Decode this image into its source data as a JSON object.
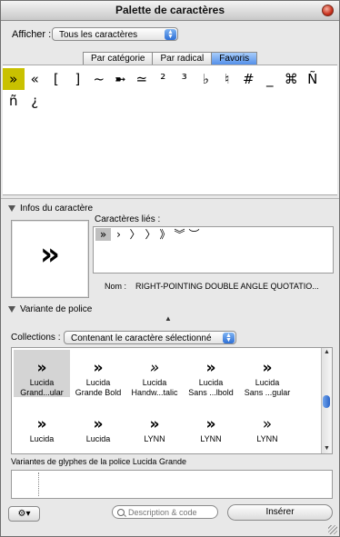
{
  "window": {
    "title": "Palette de caractères"
  },
  "show": {
    "label": "Afficher :",
    "value": "Tous les caractères"
  },
  "tabs": [
    {
      "label": "Par catégorie",
      "selected": false
    },
    {
      "label": "Par radical",
      "selected": false
    },
    {
      "label": "Favoris",
      "selected": true
    }
  ],
  "favorites": [
    "»",
    "«",
    "[",
    "]",
    "~",
    "➼",
    "≃",
    "²",
    "³",
    "♭",
    "♮",
    "#",
    "_",
    "⌘",
    "Ñ",
    "ñ",
    "¿"
  ],
  "selected_index": 0,
  "char_info": {
    "header": "Infos du caractère",
    "preview": "»",
    "linked_label": "Caractères liés :",
    "linked": [
      "»",
      "›",
      "〉",
      "〉",
      "》",
      "︾",
      "︶"
    ],
    "name_label": "Nom :",
    "name_value": "RIGHT-POINTING DOUBLE ANGLE QUOTATIO..."
  },
  "font_variant": {
    "header": "Variante de police",
    "collections_label": "Collections :",
    "collections_value": "Contenant le caractère sélectionné",
    "fonts": [
      {
        "glyph": "»",
        "line1": "Lucida",
        "line2": "Grand...ular",
        "selected": true
      },
      {
        "glyph": "»",
        "line1": "Lucida",
        "line2": "Grande Bold",
        "selected": false
      },
      {
        "glyph": "»",
        "line1": "Lucida",
        "line2": "Handw...talic",
        "selected": false
      },
      {
        "glyph": "»",
        "line1": "Lucida",
        "line2": "Sans ...lbold",
        "selected": false
      },
      {
        "glyph": "»",
        "line1": "Lucida",
        "line2": "Sans ...gular",
        "selected": false
      },
      {
        "glyph": "»",
        "line1": "Lucida",
        "line2": "",
        "selected": false
      },
      {
        "glyph": "»",
        "line1": "Lucida",
        "line2": "",
        "selected": false
      },
      {
        "glyph": "»",
        "line1": "LYNN",
        "line2": "",
        "selected": false
      },
      {
        "glyph": "»",
        "line1": "LYNN",
        "line2": "",
        "selected": false
      },
      {
        "glyph": "»",
        "line1": "LYNN",
        "line2": "",
        "selected": false
      }
    ]
  },
  "glyph_variants": {
    "label": "Variantes de glyphes de la police Lucida Grande"
  },
  "bottom": {
    "gear_icon": "gear-icon",
    "search_placeholder": "Description & code",
    "insert_label": "Insérer"
  }
}
